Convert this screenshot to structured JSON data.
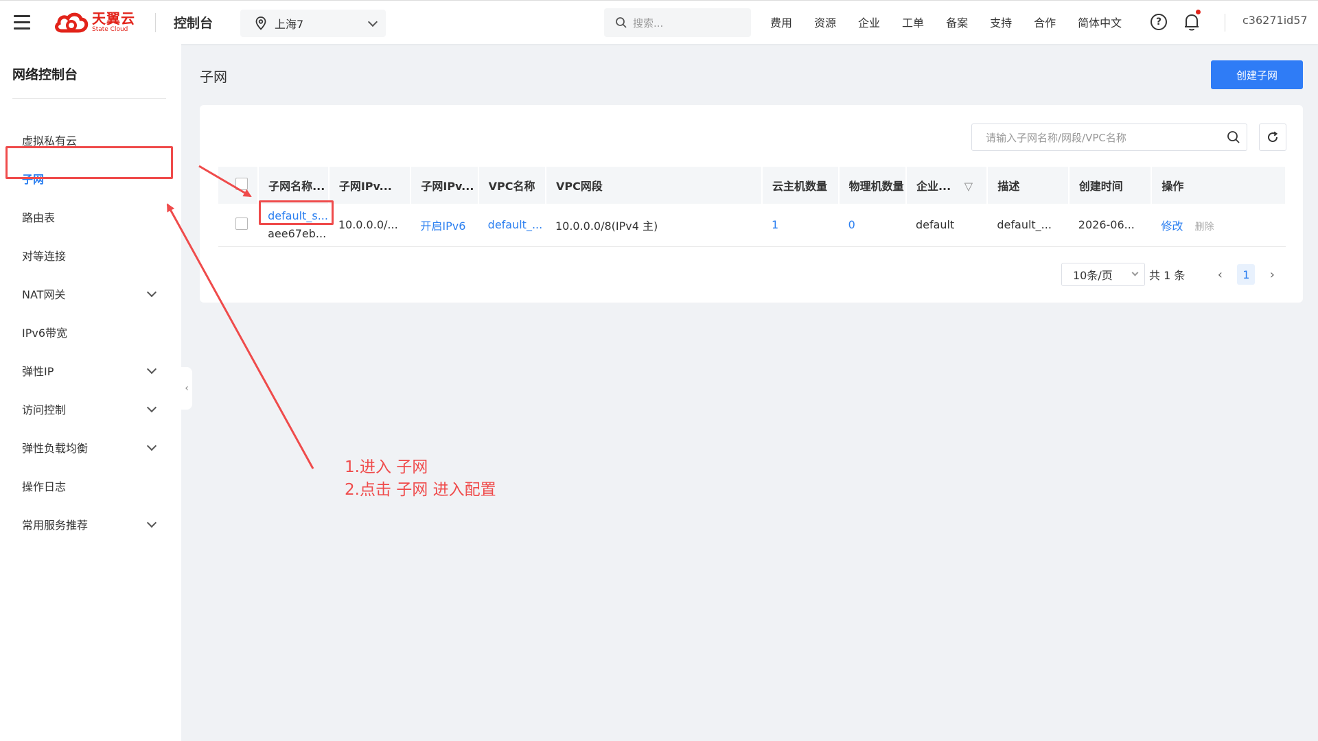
{
  "header": {
    "logo_cn": "天翼云",
    "logo_en": "State Cloud",
    "console_title": "控制台",
    "region": "上海7",
    "search_placeholder": "搜索...",
    "nav": [
      "费用",
      "资源",
      "企业",
      "工单",
      "备案",
      "支持",
      "合作",
      "简体中文"
    ],
    "help": "?",
    "user": "c36271id57"
  },
  "sidebar": {
    "title": "网络控制台",
    "items": [
      {
        "label": "虚拟私有云",
        "expandable": false
      },
      {
        "label": "子网",
        "expandable": false,
        "active": true
      },
      {
        "label": "路由表",
        "expandable": false
      },
      {
        "label": "对等连接",
        "expandable": false
      },
      {
        "label": "NAT网关",
        "expandable": true
      },
      {
        "label": "IPv6带宽",
        "expandable": false
      },
      {
        "label": "弹性IP",
        "expandable": true
      },
      {
        "label": "访问控制",
        "expandable": true
      },
      {
        "label": "弹性负载均衡",
        "expandable": true
      },
      {
        "label": "操作日志",
        "expandable": false
      },
      {
        "label": "常用服务推荐",
        "expandable": true
      }
    ]
  },
  "main": {
    "page_title": "子网",
    "create_button": "创建子网",
    "filter_placeholder": "请输入子网名称/网段/VPC名称",
    "columns": [
      "子网名称...",
      "子网IPv...",
      "子网IPv...",
      "VPC名称",
      "VPC网段",
      "云主机数量",
      "物理机数量",
      "企业...",
      "描述",
      "创建时间",
      "操作"
    ],
    "rows": [
      {
        "name": "default_s...",
        "id": "aee67eb...",
        "ipv4": "10.0.0.0/...",
        "ipv6": "开启IPv6",
        "vpc_name": "default_...",
        "vpc_cidr": "10.0.0.0/8(IPv4 主)",
        "vm_count": "1",
        "bm_count": "0",
        "enterprise": "default",
        "description": "default_...",
        "created": "2026-06...",
        "action_edit": "修改",
        "action_delete": "删除"
      }
    ],
    "pagination": {
      "page_size": "10条/页",
      "total": "共 1 条",
      "current_page": "1"
    }
  },
  "annotation": {
    "line1": "1.进入 子网",
    "line2": "2.点击 子网 进入配置",
    "color": "#ef4b4b"
  }
}
